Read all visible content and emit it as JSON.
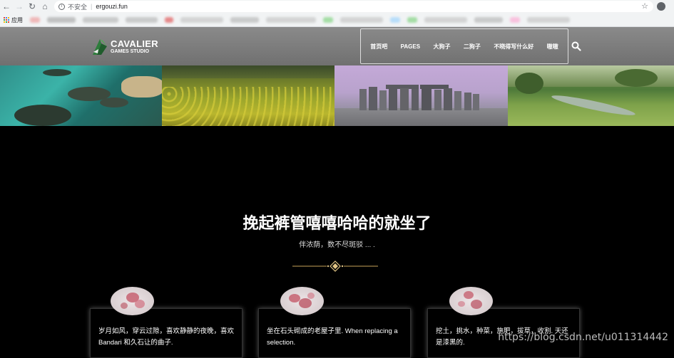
{
  "browser": {
    "security_label": "不安全",
    "url": "ergouzi.fun",
    "apps_label": "应用"
  },
  "header": {
    "logo_line1": "CAVALIER",
    "logo_line2": "GAMES STUDIO",
    "menu": [
      "首页吧",
      "PAGES",
      "大狗子",
      "二狗子",
      "不晓得写什么好",
      "嗷嗷"
    ]
  },
  "main": {
    "title": "挽起裤管嘻嘻哈哈的就坐了",
    "subtitle": "伴浓荫，数不尽斑驳 ... ."
  },
  "cards": [
    {
      "text": "岁月如风，穿云过隙，喜欢静静的夜晚，喜欢Bandari 和久石让的曲子."
    },
    {
      "text": "坐在石头砌成的老屋子里. When replacing a selection."
    },
    {
      "text": "挖土，挑水，种菜，施肥，拔草，收割. 天还是漆黑的."
    }
  ],
  "watermark": "https://blog.csdn.net/u011314442",
  "colors": {
    "accent_gold": "#c9a35a",
    "header_bg": "#7d7d7d"
  }
}
